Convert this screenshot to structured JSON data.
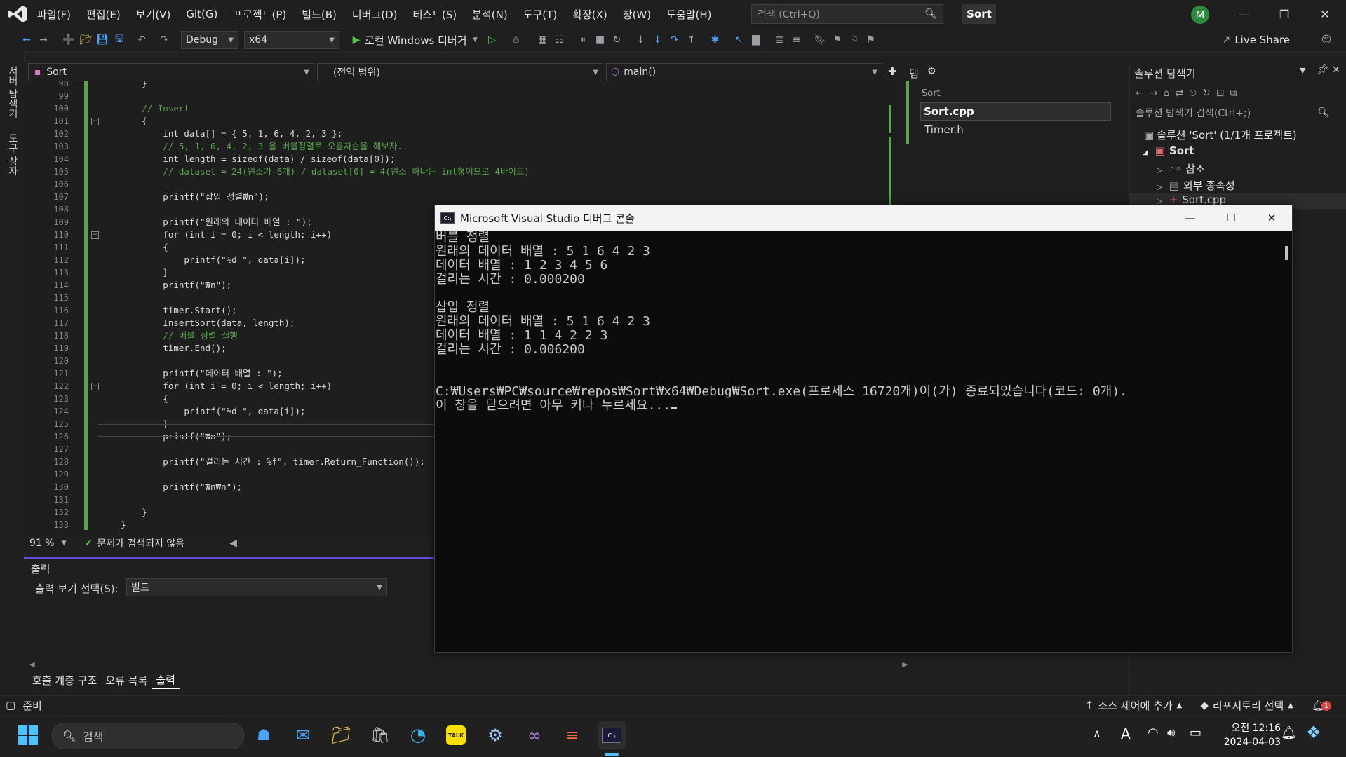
{
  "menu": {
    "items": [
      "파일(F)",
      "편집(E)",
      "보기(V)",
      "Git(G)",
      "프로젝트(P)",
      "빌드(B)",
      "디버그(D)",
      "테스트(S)",
      "분석(N)",
      "도구(T)",
      "확장(X)",
      "창(W)",
      "도움말(H)"
    ],
    "search_placeholder": "검색 (Ctrl+Q)",
    "solution_badge": "Sort",
    "avatar_letter": "M"
  },
  "toolbar": {
    "config": "Debug",
    "platform": "x64",
    "debugger_label": "로컬 Windows 디버거",
    "live_share": "Live Share"
  },
  "left_rail": [
    "서버 탐색기",
    "도구 상자"
  ],
  "navbar": {
    "project": "Sort",
    "scope": "(전역 범위)",
    "function": "main()"
  },
  "editor": {
    "lines": [
      {
        "n": "98",
        "t": "        }"
      },
      {
        "n": "99",
        "t": ""
      },
      {
        "n": "100",
        "t": "        // Insert"
      },
      {
        "n": "101",
        "t": "        {"
      },
      {
        "n": "102",
        "t": "            int data[] = { 5, 1, 6, 4, 2, 3 };"
      },
      {
        "n": "103",
        "t": "            // 5, 1, 6, 4, 2, 3 을 버블정렬로 오름차순을 해보자.."
      },
      {
        "n": "104",
        "t": "            int length = sizeof(data) / sizeof(data[0]);"
      },
      {
        "n": "105",
        "t": "            // dataset = 24(원소가 6개) / dataset[0] = 4(원소 하나는 int형이므로 4바이트)"
      },
      {
        "n": "106",
        "t": ""
      },
      {
        "n": "107",
        "t": "            printf(\"삽입 정렬₩n\");"
      },
      {
        "n": "108",
        "t": ""
      },
      {
        "n": "109",
        "t": "            printf(\"원래의 데이터 배열 : \");"
      },
      {
        "n": "110",
        "t": "            for (int i = 0; i < length; i++)"
      },
      {
        "n": "111",
        "t": "            {"
      },
      {
        "n": "112",
        "t": "                printf(\"%d \", data[i]);"
      },
      {
        "n": "113",
        "t": "            }"
      },
      {
        "n": "114",
        "t": "            printf(\"₩n\");"
      },
      {
        "n": "115",
        "t": ""
      },
      {
        "n": "116",
        "t": "            timer.Start();"
      },
      {
        "n": "117",
        "t": "            InsertSort(data, length);"
      },
      {
        "n": "118",
        "t": "            // 버블 정렬 실행"
      },
      {
        "n": "119",
        "t": "            timer.End();"
      },
      {
        "n": "120",
        "t": ""
      },
      {
        "n": "121",
        "t": "            printf(\"데이터 배열 : \");"
      },
      {
        "n": "122",
        "t": "            for (int i = 0; i < length; i++)"
      },
      {
        "n": "123",
        "t": "            {"
      },
      {
        "n": "124",
        "t": "                printf(\"%d \", data[i]);"
      },
      {
        "n": "125",
        "t": "            }"
      },
      {
        "n": "126",
        "t": "            printf(\"₩n\");"
      },
      {
        "n": "127",
        "t": ""
      },
      {
        "n": "128",
        "t": "            printf(\"걸리는 시간 : %f\", timer.Return_Function());"
      },
      {
        "n": "129",
        "t": ""
      },
      {
        "n": "130",
        "t": "            printf(\"₩n₩n\");"
      },
      {
        "n": "131",
        "t": ""
      },
      {
        "n": "132",
        "t": "        }"
      },
      {
        "n": "133",
        "t": "    }"
      }
    ],
    "zoom": "91 %",
    "issues": "문제가 검색되지 않음"
  },
  "tabs_panel": {
    "header": "탭",
    "group": "Sort",
    "files": [
      "Sort.cpp",
      "Timer.h"
    ]
  },
  "output": {
    "title": "출력",
    "source_label": "출력 보기 선택(S):",
    "source_value": "빌드",
    "bottom_tabs": [
      "호출 계층 구조",
      "오류 목록",
      "출력"
    ]
  },
  "solution_explorer": {
    "title": "솔루션 탐색기",
    "search_placeholder": "솔루션 탐색기 검색(Ctrl+;)",
    "solution": "솔루션 'Sort' (1/1개 프로젝트)",
    "project": "Sort",
    "nodes": [
      "참조",
      "외부 종속성",
      "Sort.cpp"
    ]
  },
  "statusbar": {
    "ready": "준비",
    "source_control": "소스 제어에 추가",
    "repo": "리포지토리 선택",
    "notif_count": "1"
  },
  "console": {
    "title": "Microsoft Visual Studio 디버그 콘솔",
    "lines": [
      "버블 정렬",
      "원래의 데이터 배열 : 5 1 6 4 2 3",
      "데이터 배열 : 1 2 3 4 5 6",
      "걸리는 시간 : 0.000200",
      "",
      "삽입 정렬",
      "원래의 데이터 배열 : 5 1 6 4 2 3",
      "데이터 배열 : 1 1 4 2 2 3",
      "걸리는 시간 : 0.006200",
      "",
      "",
      "C:₩Users₩PC₩source₩repos₩Sort₩x64₩Debug₩Sort.exe(프로세스 16720개)이(가) 종료되었습니다(코드: 0개).",
      "이 창을 닫으려면 아무 키나 누르세요..."
    ]
  },
  "taskbar": {
    "search_placeholder": "검색",
    "clock_time": "오전 12:16",
    "clock_date": "2024-04-03"
  }
}
